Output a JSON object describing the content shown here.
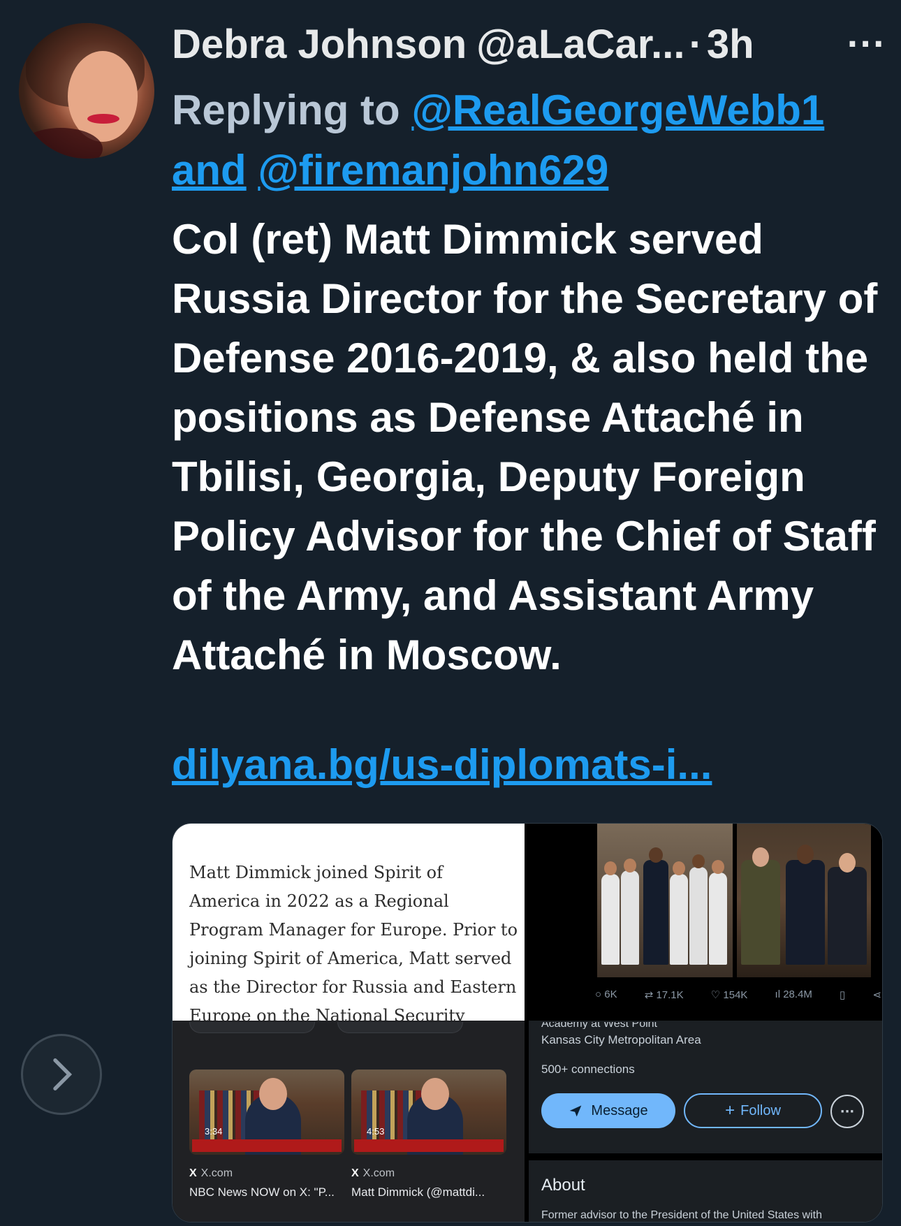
{
  "tweet": {
    "author_name": "Debra Johnson",
    "author_handle": "@aLaCar...",
    "separator": "·",
    "time": "3h",
    "more_label": "···",
    "replying_prefix": "Replying to",
    "reply_handle_1": "@RealGeorgeWebb1",
    "reply_and": "and",
    "reply_handle_2": "@firemanjohn629",
    "text": "Col (ret) Matt Dimmick served Russia Director for the Secretary of Defense 2016-2019, & also held the positions as Defense Attaché in Tbilisi, Georgia, Deputy Foreign Policy Advisor for the Chief of Staff of the Army, and Assistant Army Attaché in Moscow.",
    "link": "dilyana.bg/us-diplomats-i..."
  },
  "media": {
    "bio_paragraph": "Matt Dimmick joined Spirit of America in 2022 as a Regional Program Manager for Europe. Prior to joining Spirit of America, Matt served as the Director for Russia and Eastern Europe on the National Security Council Staff. Matt",
    "videos": [
      {
        "duration": "3:34",
        "source": "X.com",
        "title": "NBC News NOW on X: \"P..."
      },
      {
        "duration": "4:53",
        "source": "X.com",
        "title": "Matt Dimmick (@mattdi..."
      }
    ],
    "stats": {
      "replies": "6K",
      "reposts": "17.1K",
      "likes": "154K",
      "views": "28.4M"
    },
    "profile": {
      "cut_text": "Academy at West Point",
      "location": "Kansas City Metropolitan Area",
      "connections": "500+ connections",
      "message_label": "Message",
      "follow_label": "Follow",
      "more_label": "···",
      "about_heading": "About",
      "about_text": "Former advisor to the President of the United States with"
    }
  },
  "colors": {
    "background": "#15202b",
    "link": "#1d9bf0",
    "reply_muted": "#b9c7d6"
  }
}
